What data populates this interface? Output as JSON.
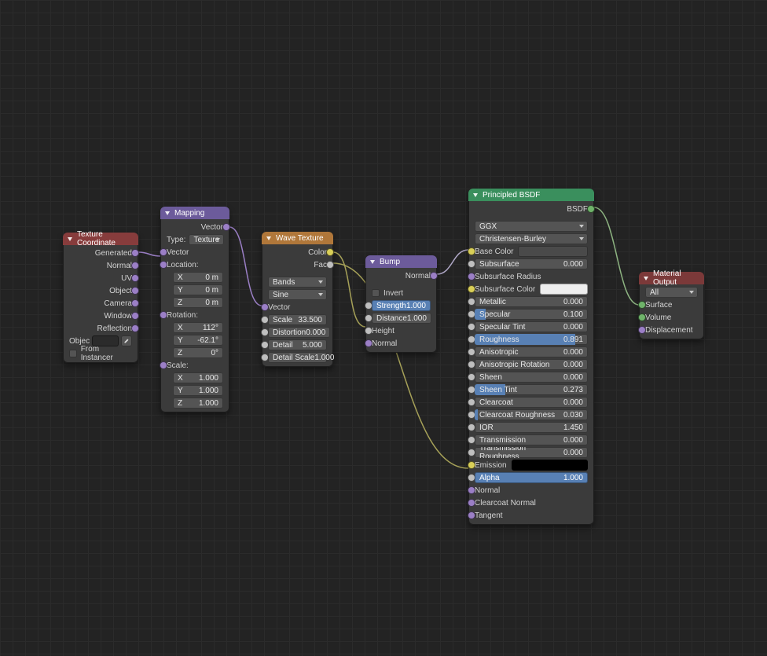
{
  "texcoord": {
    "title": "Texture Coordinate",
    "outputs": [
      "Generated",
      "Normal",
      "UV",
      "Object",
      "Camera",
      "Window",
      "Reflection"
    ],
    "object_label": "Objec",
    "from_instancer": "From Instancer"
  },
  "mapping": {
    "title": "Mapping",
    "out_vector": "Vector",
    "type_label": "Type:",
    "type_value": "Texture",
    "in_vector": "Vector",
    "location_label": "Location:",
    "location": {
      "x_label": "X",
      "x_val": "0 m",
      "y_label": "Y",
      "y_val": "0 m",
      "z_label": "Z",
      "z_val": "0 m"
    },
    "rotation_label": "Rotation:",
    "rotation": {
      "x_label": "X",
      "x_val": "112°",
      "y_label": "Y",
      "y_val": "-62.1°",
      "z_label": "Z",
      "z_val": "0°"
    },
    "scale_label": "Scale:",
    "scale": {
      "x_label": "X",
      "x_val": "1.000",
      "y_label": "Y",
      "y_val": "1.000",
      "z_label": "Z",
      "z_val": "1.000"
    }
  },
  "wave": {
    "title": "Wave Texture",
    "out_color": "Color",
    "out_fac": "Fac",
    "type": "Bands",
    "profile": "Sine",
    "in_vector": "Vector",
    "scale_label": "Scale",
    "scale_val": "33.500",
    "distortion_label": "Distortion",
    "distortion_val": "0.000",
    "detail_label": "Detail",
    "detail_val": "5.000",
    "detailscale_label": "Detail Scale",
    "detailscale_val": "1.000"
  },
  "bump": {
    "title": "Bump",
    "out_normal": "Normal",
    "invert": "Invert",
    "strength_label": "Strength",
    "strength_val": "1.000",
    "distance_label": "Distance",
    "distance_val": "1.000",
    "height": "Height",
    "normal_in": "Normal"
  },
  "bsdf": {
    "title": "Principled BSDF",
    "out_bsdf": "BSDF",
    "distribution": "GGX",
    "subsurface_method": "Christensen-Burley",
    "base_color": "Base Color",
    "base_color_swatch": "#4a4a4a",
    "subsurface": "Subsurface",
    "subsurface_val": "0.000",
    "subsurface_radius": "Subsurface Radius",
    "subsurface_color": "Subsurface Color",
    "subsurface_color_swatch": "#eeeeee",
    "metallic": "Metallic",
    "metallic_val": "0.000",
    "specular": "Specular",
    "specular_val": "0.100",
    "specular_tint": "Specular Tint",
    "specular_tint_val": "0.000",
    "roughness": "Roughness",
    "roughness_val": "0.891",
    "anisotropic": "Anisotropic",
    "anisotropic_val": "0.000",
    "aniso_rot": "Anisotropic Rotation",
    "aniso_rot_val": "0.000",
    "sheen": "Sheen",
    "sheen_val": "0.000",
    "sheen_tint": "Sheen Tint",
    "sheen_tint_val": "0.273",
    "clearcoat": "Clearcoat",
    "clearcoat_val": "0.000",
    "clearcoat_rough": "Clearcoat Roughness",
    "clearcoat_rough_val": "0.030",
    "ior": "IOR",
    "ior_val": "1.450",
    "transmission": "Transmission",
    "transmission_val": "0.000",
    "trans_rough": "Transmission Roughness",
    "trans_rough_val": "0.000",
    "emission": "Emission",
    "emission_swatch": "#000000",
    "alpha": "Alpha",
    "alpha_val": "1.000",
    "normal": "Normal",
    "clearcoat_normal": "Clearcoat Normal",
    "tangent": "Tangent"
  },
  "output": {
    "title": "Material Output",
    "target": "All",
    "surface": "Surface",
    "volume": "Volume",
    "displacement": "Displacement"
  }
}
